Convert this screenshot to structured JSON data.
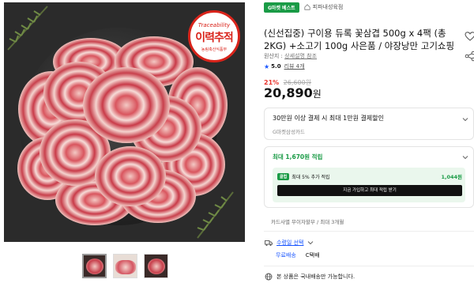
{
  "gallery": {
    "seal": {
      "top": "Traceability",
      "main": "이력추적",
      "sub": "농림축산식품부"
    },
    "thumbnails": 3
  },
  "header": {
    "badge": "G마켓 베스트",
    "store_name": "피파내성육점"
  },
  "product": {
    "title": "(신선집중) 구이용 듀록 꽃삼겹 500g x 4팩 (총 2KG) +소고기 100g 사은품 / 야장낭만 고기쇼핑",
    "origin_label": "원산지 :",
    "origin_link": "상세설명 참조",
    "rating_score": "5.0",
    "rating_count": "리뷰 4개",
    "discount": "21%",
    "original_price": "26,600원",
    "price": "20,890",
    "price_unit": "원"
  },
  "card_discount": {
    "title": "30만원 이상 결제 시 최대 1만원 결제할인",
    "subtitle": "G마켓삼성카드"
  },
  "points": {
    "label": "최대 1,670원 적립",
    "badge": "클럽",
    "club_text": "최대 5% 추가 적립",
    "club_amount": "1,044원",
    "cta": "지금 가입하고 최대 적립 받기"
  },
  "installment": "카드사별 무이자할부 / 최대 3개월",
  "shipping": {
    "method": "수령일 선택",
    "fee": "무료배송",
    "type": "C택배",
    "domestic": "본 상품은 국내배송만 가능합니다."
  },
  "colors": {
    "brand_green": "#1a9b46",
    "discount_red": "#e8352e",
    "link_blue": "#1a56ff"
  }
}
